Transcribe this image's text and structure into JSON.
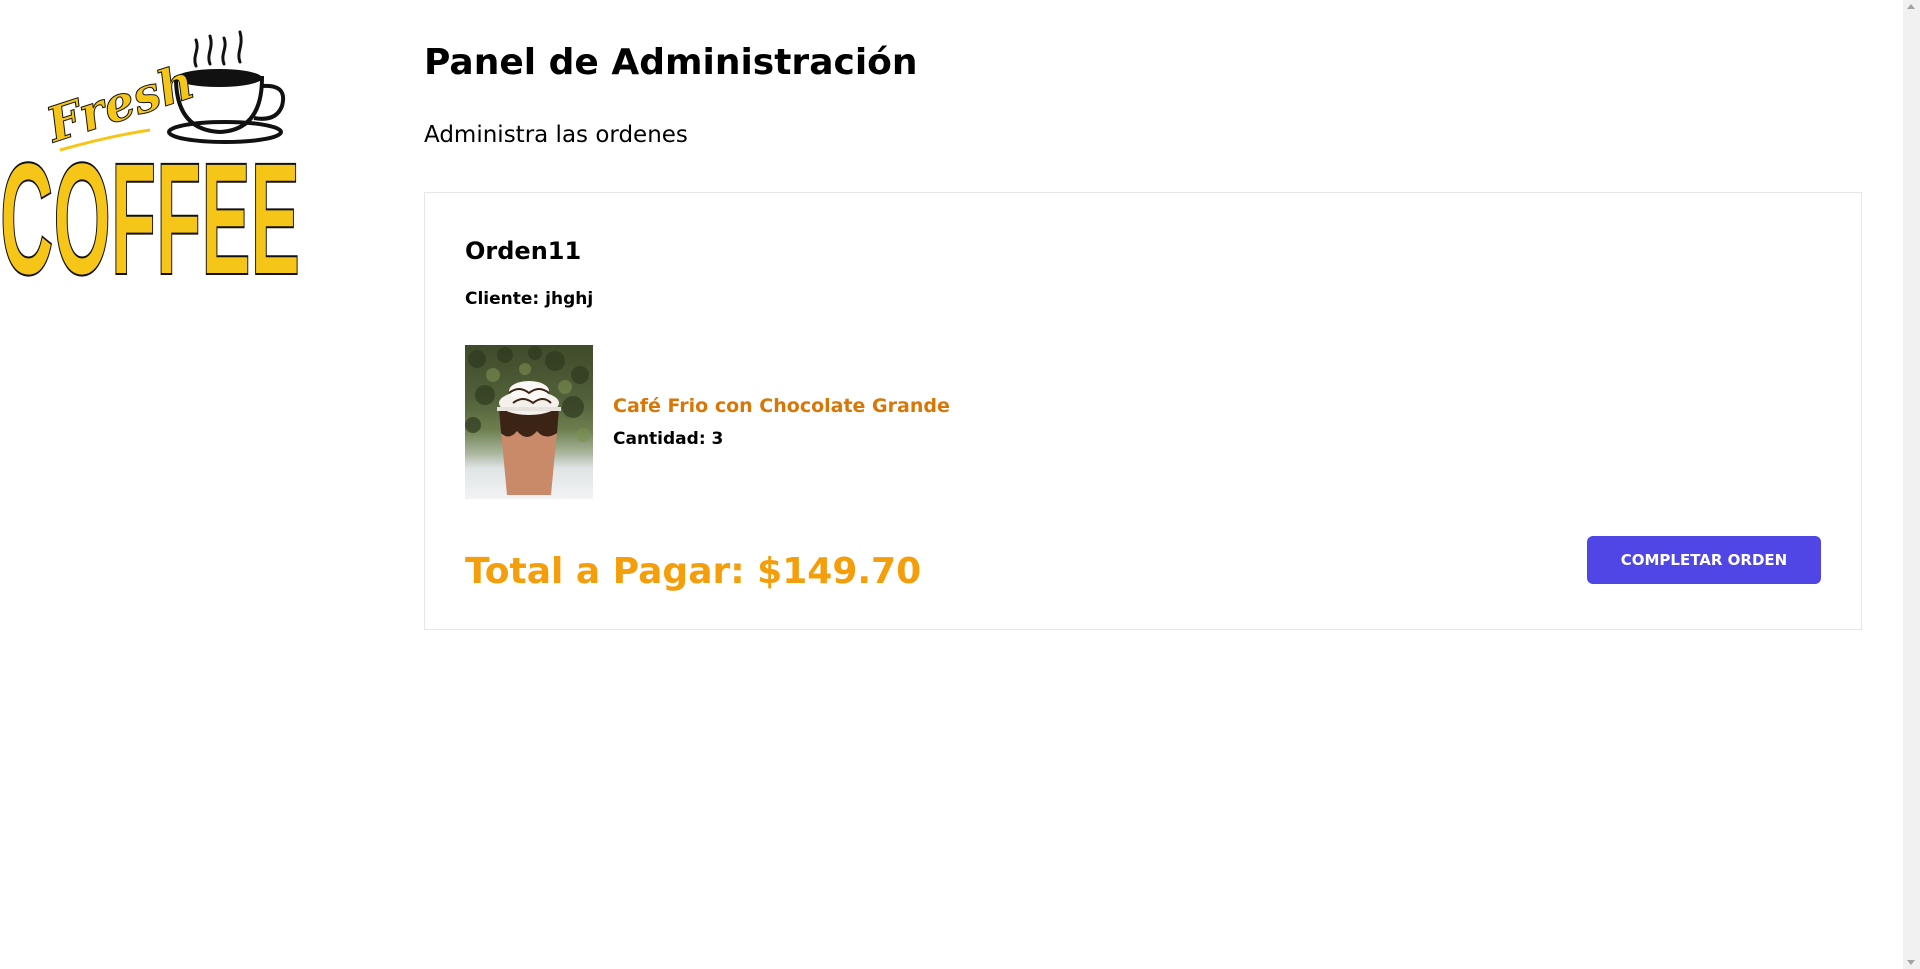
{
  "logo": {
    "text_top": "Fresh",
    "text_bottom": "COFFEE",
    "brand_color": "#f5c518"
  },
  "header": {
    "title": "Panel de Administración",
    "subtitle": "Administra las ordenes"
  },
  "order": {
    "title": "Orden11",
    "client_label": "Cliente:",
    "client_name": "jhghj",
    "items": [
      {
        "name": "Café Frio con Chocolate Grande",
        "quantity_label": "Cantidad:",
        "quantity": "3",
        "image_icon": "iced-coffee-photo"
      }
    ],
    "total_text": "Total a Pagar: $149.70",
    "complete_button_label": "Completar Orden"
  },
  "colors": {
    "accent_button": "#4f46e5",
    "product_name": "#d97706",
    "total": "#f59e0b",
    "card_border": "#e5e7eb"
  }
}
